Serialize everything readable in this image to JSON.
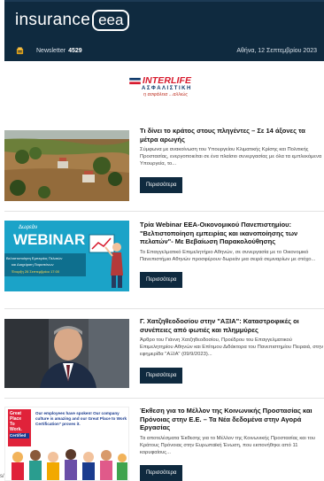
{
  "header": {
    "logo_word": "insurance",
    "logo_badge": "eea",
    "newsletter_label": "Newsletter",
    "newsletter_number": "4529",
    "date": "Αθήνα, 12 Σεπτεμβρίου 2023"
  },
  "sponsor": {
    "brand": "INTERLIFE",
    "sub": "ΑΣΦΑΛΙΣΤΙΚΗ",
    "tagline": "η ασφάλεια ...αλλιώς"
  },
  "articles": [
    {
      "title": "Τι δίνει το κράτος στους πληγέντες – Σε 14 άξονες τα μέτρα αρωγής",
      "excerpt": "Σύμφωνα με ανακοίνωση του Υπουργείου Κλιματικής Κρίσης και Πολιτικής Προστασίας, ενεργοποιείται σε ένα πλαίσιο συνεργασίας με όλα τα εμπλεκόμενα Υπουργεία, το...",
      "button": "Περισσότερα"
    },
    {
      "title": "Τρία Webinar ΕΕΑ-Οικονομικού Πανεπιστημίου: \"Βελτιστοποίηση εμπειρίας και ικανοποίησης των πελατών\"- Με Βεβαίωση Παρακολούθησης",
      "excerpt": "Το Επαγγελματικό Επιμελητήριο Αθηνών, σε συνεργασία με το Οικονομικό Πανεπιστήμιο Αθηνών προσφέρουν δωρεάν μια σειρά σεμιναρίων με στόχο...",
      "button": "Περισσότερα",
      "image_text": {
        "top": "Δωρεάν",
        "big": "WEBINAR",
        "line1": "Βελτιστοποίηση Εμπειρίας Πελατών",
        "line2": "και Διαχείριση Παραπόνων",
        "line3": "Έναρξη 26 Σεπτεμβρίου 17:00"
      }
    },
    {
      "title": "Γ. Χατζηθεοδοσίου στην \"ΑΞΙΑ\": Καταστροφικές οι συνέπειες από φωτιές και πλημμύρες",
      "excerpt": "Άρθρο του Γιάννη Χατζηθεοδοσίου, Προέδρου του Επαγγελματικού Επιμελητηρίου Αθηνών και Επίτιμου Διδάκτορα του Πανεπιστημίου Πειραιά, στην εφημερίδα \"ΑΞΙΑ\" (09/9/2023)...",
      "button": "Περισσότερα"
    },
    {
      "title": "Έκθεση για το Μέλλον της Κοινωνικής Προστασίας και Πρόνοιας στην Ε.Ε. – Τα Νέα δεδομένα στην Αγορά Εργασίας",
      "excerpt": "Τα αποτελέσματα Έκθεσης για το Μέλλον της Κοινωνικής Προστασίας και του Κράτους Πρόνοιας στην Ευρωπαϊκή Ένωση, που εκπονήθηκε από 11 κορυφαίους...",
      "button": "Περισσότερα",
      "image_text": {
        "badge1": "Great",
        "badge2": "Place",
        "badge3": "To",
        "badge4": "Work.",
        "badge5": "Certified",
        "quote": "Our employees have spoken! Our company culture is amazing and our Great Place to Work Certification\" proves it."
      }
    }
  ],
  "corner_text": "s/"
}
